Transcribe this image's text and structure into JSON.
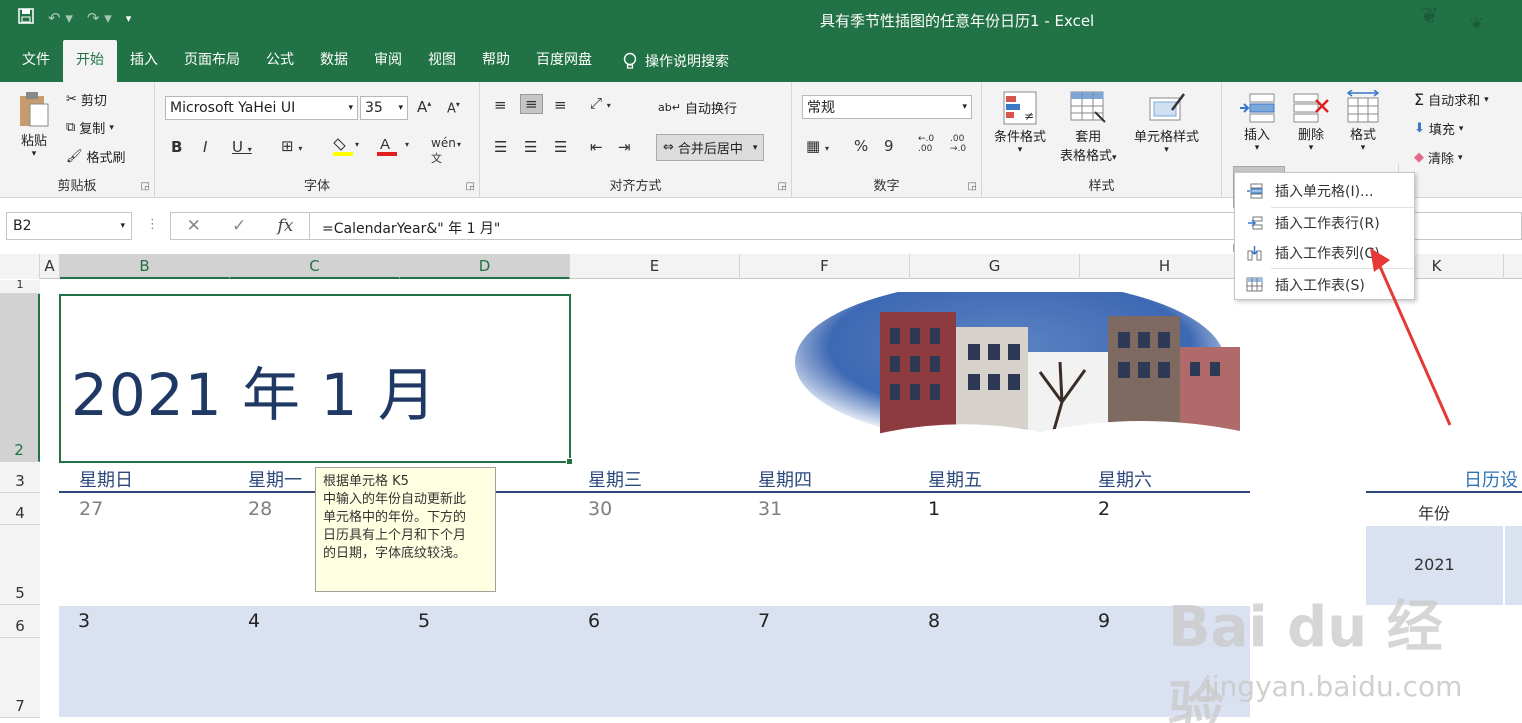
{
  "window": {
    "title": "具有季节性插图的任意年份日历1  -  Excel",
    "qat": [
      "save-icon",
      "undo-icon",
      "redo-icon",
      "customize-icon"
    ]
  },
  "tabs": [
    "文件",
    "开始",
    "插入",
    "页面布局",
    "公式",
    "数据",
    "审阅",
    "视图",
    "帮助",
    "百度网盘"
  ],
  "active_tab": "开始",
  "tell_me": "操作说明搜索",
  "ribbon": {
    "clipboard": {
      "label": "剪贴板",
      "paste": "粘贴",
      "cut": "剪切",
      "copy": "复制",
      "format_painter": "格式刷"
    },
    "font": {
      "label": "字体",
      "name": "Microsoft YaHei UI",
      "size": "35"
    },
    "alignment": {
      "label": "对齐方式",
      "wrap": "自动换行",
      "merge": "合并后居中"
    },
    "number": {
      "label": "数字",
      "format": "常规"
    },
    "styles": {
      "label": "样式",
      "conditional": "条件格式",
      "table_fmt_1": "套用",
      "table_fmt_2": "表格格式",
      "cell_styles": "单元格样式"
    },
    "cells": {
      "insert": "插入",
      "delete": "删除",
      "format": "格式"
    },
    "editing": {
      "autosum": "自动求和",
      "fill": "填充",
      "clear": "清除"
    }
  },
  "formula_bar": {
    "name_box": "B2",
    "formula": "=CalendarYear&\" 年 1 月\""
  },
  "columns": [
    "A",
    "B",
    "C",
    "D",
    "E",
    "F",
    "G",
    "H",
    "K"
  ],
  "rows": [
    "1",
    "2",
    "3",
    "4",
    "5",
    "6",
    "7"
  ],
  "sheet": {
    "title": "2021 年 1 月",
    "day_names": [
      "星期日",
      "星期一",
      "星期三",
      "星期四",
      "星期五",
      "星期六"
    ],
    "week1": [
      "27",
      "28",
      "30",
      "31",
      "1",
      "2"
    ],
    "week2": [
      "3",
      "4",
      "5",
      "6",
      "7",
      "8",
      "9"
    ],
    "settings_title": "日历设",
    "year_label": "年份",
    "year_value": "2021"
  },
  "comment": {
    "lines": [
      "根据单元格 K5",
      "中输入的年份自动更新此",
      "单元格中的年份。下方的",
      "日历具有上个月和下个月",
      "的日期，字体底纹较浅。"
    ]
  },
  "insert_menu": [
    "插入单元格(I)...",
    "插入工作表行(R)",
    "插入工作表列(C)",
    "插入工作表(S)"
  ],
  "watermark": {
    "brand": "Bai du 经验",
    "url": "jingyan.baidu.com"
  },
  "colors": {
    "excel_green": "#217346",
    "calendar_blue": "#2e4a7d",
    "band": "#dae1f1",
    "arrow_red": "#e53935"
  }
}
